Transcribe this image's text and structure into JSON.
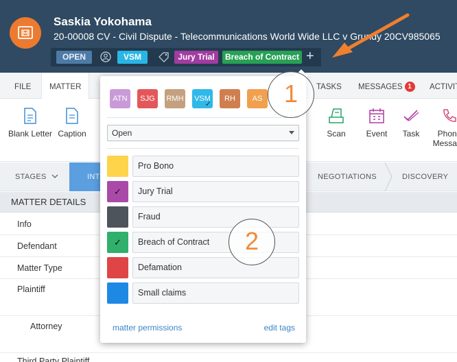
{
  "header": {
    "client_name": "Saskia Yokohama",
    "matter_line": "20-00008 CV - Civil Dispute - Telecommunications World Wide LLC v Grundy 20CV985065",
    "status": "OPEN",
    "assignee": "VSM",
    "tags": [
      "Jury Trial",
      "Breach of Contract"
    ],
    "add_tag_glyph": "+"
  },
  "tabs": {
    "file": "FILE",
    "matter": "MATTER",
    "tasks": "TASKS",
    "messages": "MESSAGES",
    "messages_count": "1",
    "activities": "ACTIVITIES"
  },
  "ribbon": {
    "blank_letter": "Blank Letter",
    "caption": "Caption",
    "partial_t": "t",
    "scan": "Scan",
    "event": "Event",
    "task": "Task",
    "phone_message": "Phone Message"
  },
  "stages": {
    "label": "STAGES",
    "active": "INT",
    "negotiations": "NEGOTIATIONS",
    "discovery": "DISCOVERY"
  },
  "details": {
    "header": "MATTER DETAILS",
    "rows": [
      "Info",
      "Defendant",
      "Matter Type",
      "Plaintiff",
      "Attorney",
      "Third Party Plaintiff"
    ]
  },
  "popover": {
    "initials": [
      "ATN",
      "SJG",
      "RMH",
      "VSM",
      "RH",
      "AS"
    ],
    "initial_colors": [
      "#c99ad8",
      "#e3575a",
      "#c4a07f",
      "#2fb8e8",
      "#cf7f4f",
      "#f0a04f"
    ],
    "status_value": "Open",
    "tags": [
      {
        "label": "Pro Bono",
        "color": "#fdd44b",
        "checked": false
      },
      {
        "label": "Jury Trial",
        "color": "#a94aa8",
        "checked": true
      },
      {
        "label": "Fraud",
        "color": "#4e545b",
        "checked": false
      },
      {
        "label": "Breach of Contract",
        "color": "#2fb06b",
        "checked": true
      },
      {
        "label": "Defamation",
        "color": "#e04545",
        "checked": false
      },
      {
        "label": "Small claims",
        "color": "#1e88e5",
        "checked": false
      }
    ],
    "check_glyph": "✓",
    "matter_permissions": "matter permissions",
    "edit_tags": "edit tags"
  },
  "callouts": [
    "1",
    "2"
  ],
  "colors": {
    "header_bg": "#2f4a62",
    "accent_orange": "#ec7a30",
    "stage_active": "#5b9fe0",
    "link": "#3a83c9"
  },
  "icons": [
    "matter-logo-icon",
    "user-icon",
    "tag-icon",
    "plus-icon",
    "document-icon",
    "scan-icon",
    "calendar-icon",
    "task-check-icon",
    "phone-icon",
    "chevron-down-icon"
  ]
}
